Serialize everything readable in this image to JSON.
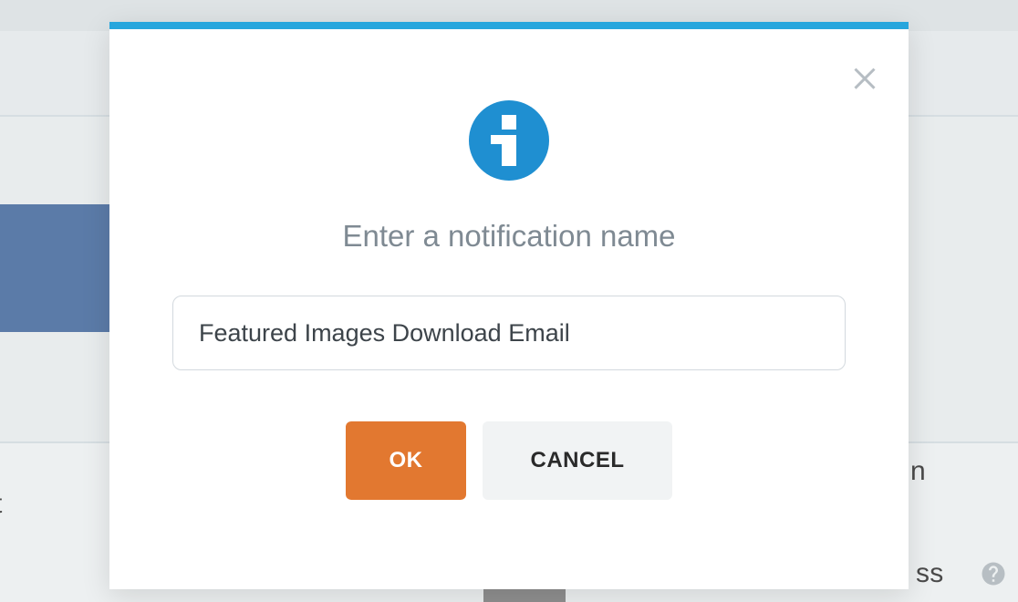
{
  "modal": {
    "title": "Enter a notification name",
    "input_value": "Featured Images Download Email",
    "ok_label": "OK",
    "cancel_label": "CANCEL"
  },
  "background": {
    "fragment_left": "t",
    "fragment_right_top": "n",
    "fragment_right_bottom": "ss"
  },
  "colors": {
    "accent_bar": "#27a6dd",
    "info_badge": "#1f8fd1",
    "primary_button": "#e27830",
    "secondary_button": "#f1f3f4"
  }
}
